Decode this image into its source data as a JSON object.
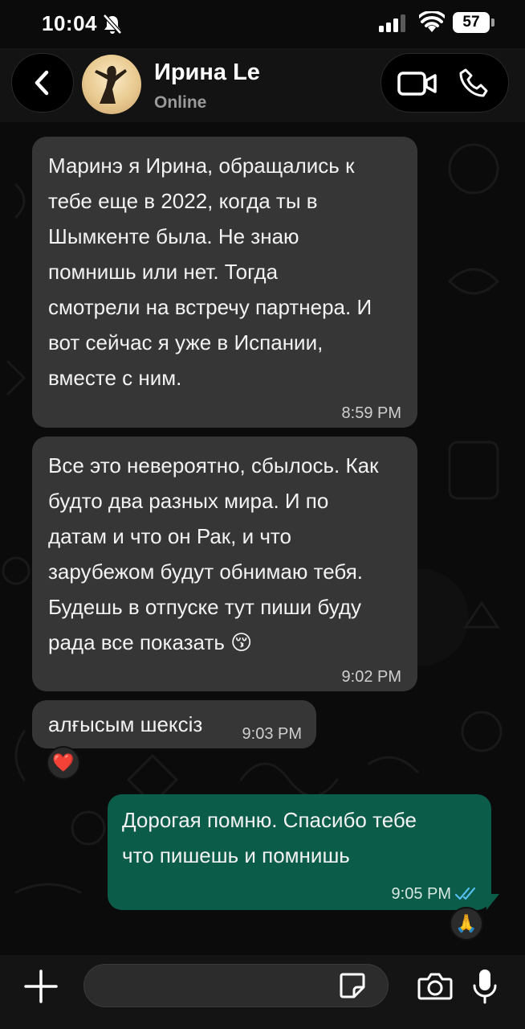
{
  "status_bar": {
    "time": "10:04",
    "battery": "57"
  },
  "header": {
    "contact_name": "Ирина Le",
    "contact_status": "Online"
  },
  "messages": [
    {
      "direction": "incoming",
      "text": "Маринэ я Ирина, обращались к\nтебе еще в 2022, когда ты в\nШымкенте была. Не знаю\nпомнишь или нет. Тогда\nсмотрели на встречу партнера. И\nвот сейчас я уже в Испании,\nвместе с ним.",
      "time": "8:59 PM"
    },
    {
      "direction": "incoming",
      "text": "Все это невероятно, сбылось. Как\nбудто два разных мира. И по\nдатам и что он Рак, и что\nзарубежом будут обнимаю тебя.\nБудешь в отпуске тут пиши буду\nрада все показать 😚",
      "time": "9:02 PM"
    },
    {
      "direction": "incoming",
      "text": "алғысым шексіз",
      "time": "9:03 PM",
      "reaction": "❤️"
    },
    {
      "direction": "outgoing",
      "text": "Дорогая помню. Спасибо тебе\nчто пишешь и помнишь",
      "time": "9:05 PM",
      "reaction": "🙏",
      "status": "read"
    }
  ],
  "input": {
    "placeholder": ""
  },
  "icons": [
    "bell-slash-icon",
    "signal-icon",
    "wifi-icon",
    "back-chevron-icon",
    "video-call-icon",
    "phone-icon",
    "read-ticks-icon",
    "plus-icon",
    "sticker-icon",
    "camera-icon",
    "microphone-icon"
  ],
  "colors": {
    "incoming_bubble": "#363636",
    "outgoing_bubble": "#0c5c4a",
    "read_ticks": "#53bdeb",
    "background": "#0b0b0b"
  }
}
